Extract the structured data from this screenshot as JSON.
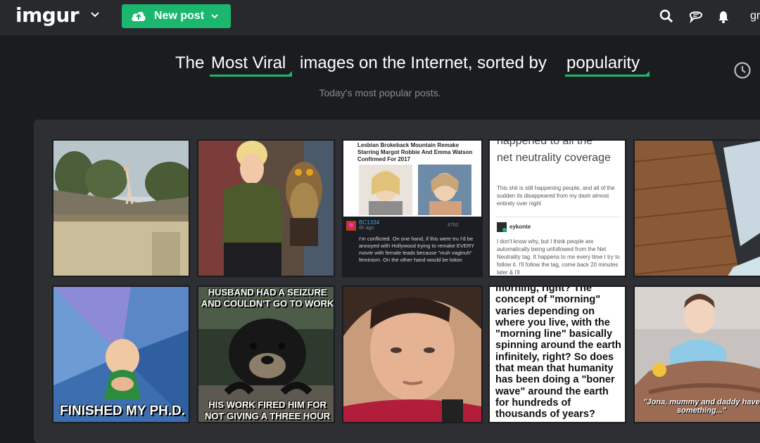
{
  "header": {
    "logo": "imgur",
    "new_post_label": "New post",
    "user_label": "gr",
    "icons": [
      "search-icon",
      "chat-icon",
      "bell-icon"
    ]
  },
  "headline": {
    "prefix": "The",
    "section": "Most Viral",
    "middle": "images on the Internet, sorted by",
    "sort": "popularity",
    "subtitle": "Today's most popular posts."
  },
  "colors": {
    "accent": "#1bb76e",
    "topbar": "#27292d",
    "background": "#1b1c20",
    "panel": "#2d2f33"
  },
  "posts": {
    "p3": {
      "title": "Lesbian Brokeback Mountain Remake Starring Margot Robbie And Emma Watson Confirmed For 2017",
      "user": "BC1334",
      "time": "6h ago",
      "count": "4792",
      "comment": "I'm conflicted. On one hand, if this were tru I'd be annoyed with Hollywood trying to remake EVERY movie with female leads because \"muh vaginuh\" feminism. On the other hand would be lotion"
    },
    "p4": {
      "head_partial": "happened to all the",
      "head": "net neutrality coverage",
      "body1": "This shit is still happening people, and all of the sudden its disappeared from my dash almost entirely over night",
      "user": "eykonte",
      "body2": "I don't know why, but I think people are automatically being unfollowed from the Net Neutrality tag. It happens to me every time I try to follow it. I'll follow the tag, come back 20 minutes later & I'll"
    },
    "p6": {
      "top": "HUSBAND HAD A SEIZURE AND COULDN'T GO TO WORK",
      "bottom": "HIS WORK FIRED HIM FOR NOT GIVING A THREE HOUR NOTICE"
    },
    "p5": {
      "caption": "FINISHED MY PH.D."
    },
    "p9": {
      "text": "morning, right? The concept of \"morning\" varies depending on where you live, with the \"morning line\" basically spinning around the earth infinitely, right? So does that mean that humanity has been doing a \"boner wave\" around the earth for hundreds of thousands of years?"
    },
    "p10": {
      "caption": "\"Jona, mummy and daddy have something...\""
    }
  }
}
